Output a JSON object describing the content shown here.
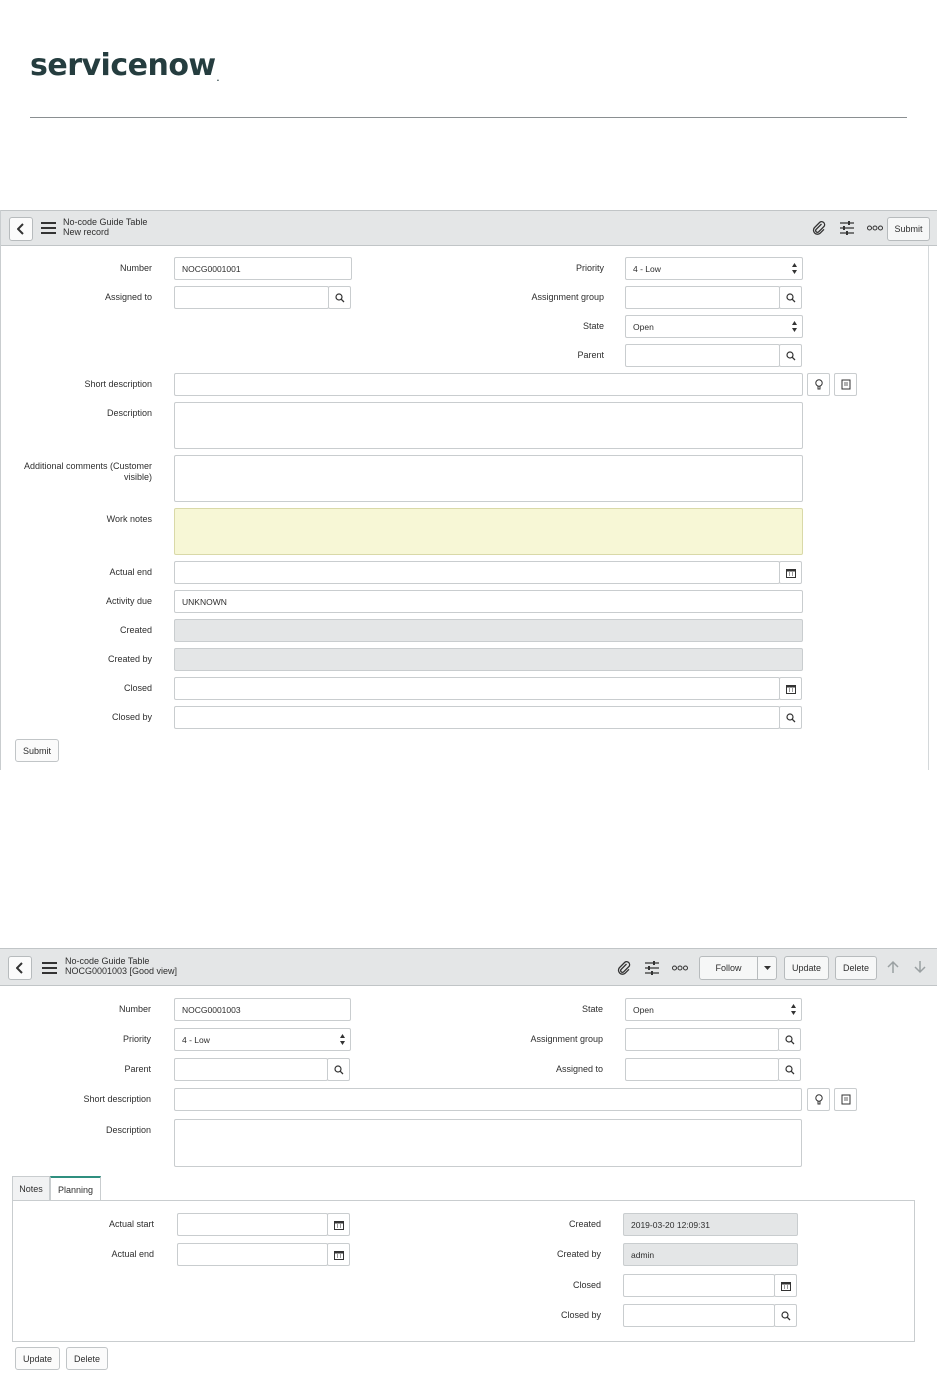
{
  "brand": {
    "logo_text": "servicenow",
    "logo_tm": "."
  },
  "form1": {
    "table_name": "No-code Guide Table",
    "record_title": "New record",
    "header_submit": "Submit",
    "labels": {
      "number": "Number",
      "assigned_to": "Assigned to",
      "priority": "Priority",
      "assignment_group": "Assignment group",
      "state": "State",
      "parent": "Parent",
      "short_description": "Short description",
      "description": "Description",
      "additional_comments": "Additional comments (Customer visible)",
      "work_notes": "Work notes",
      "actual_end": "Actual end",
      "activity_due": "Activity due",
      "created": "Created",
      "created_by": "Created by",
      "closed": "Closed",
      "closed_by": "Closed by"
    },
    "values": {
      "number": "NOCG0001001",
      "priority": "4 - Low",
      "state": "Open",
      "activity_due": "UNKNOWN"
    },
    "submit_button": "Submit"
  },
  "form2": {
    "table_name": "No-code Guide Table",
    "record_title": "NOCG0001003 [Good view]",
    "header_buttons": {
      "follow": "Follow",
      "update": "Update",
      "delete": "Delete"
    },
    "labels": {
      "number": "Number",
      "priority": "Priority",
      "parent": "Parent",
      "state": "State",
      "assignment_group": "Assignment group",
      "assigned_to": "Assigned to",
      "short_description": "Short description",
      "description": "Description",
      "actual_start": "Actual start",
      "actual_end": "Actual end",
      "created": "Created",
      "created_by": "Created by",
      "closed": "Closed",
      "closed_by": "Closed by"
    },
    "values": {
      "number": "NOCG0001003",
      "priority": "4 - Low",
      "state": "Open",
      "created": "2019-03-20 12:09:31",
      "created_by": "admin"
    },
    "tabs": [
      {
        "label": "Notes"
      },
      {
        "label": "Planning"
      }
    ],
    "active_tab": "Planning",
    "footer_buttons": {
      "update": "Update",
      "delete": "Delete"
    }
  },
  "colors": {
    "header_bg": "#e4e6e7",
    "work_notes_bg": "#f7f7d6",
    "readonly_bg": "#e4e6e7",
    "brand_green": "#62d84e",
    "brand_dark": "#253d3f"
  }
}
